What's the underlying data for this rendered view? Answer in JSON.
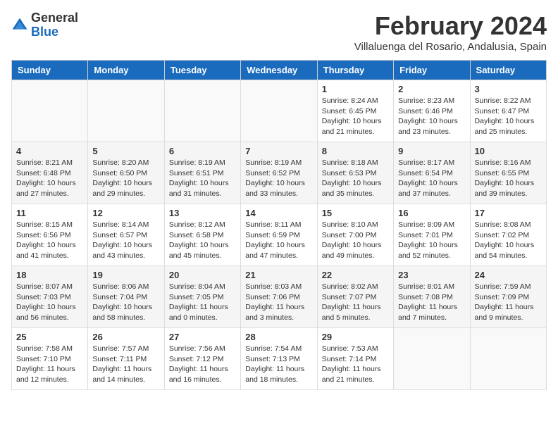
{
  "header": {
    "logo_general": "General",
    "logo_blue": "Blue",
    "title": "February 2024",
    "subtitle": "Villaluenga del Rosario, Andalusia, Spain"
  },
  "columns": [
    "Sunday",
    "Monday",
    "Tuesday",
    "Wednesday",
    "Thursday",
    "Friday",
    "Saturday"
  ],
  "weeks": [
    [
      {
        "day": "",
        "info": ""
      },
      {
        "day": "",
        "info": ""
      },
      {
        "day": "",
        "info": ""
      },
      {
        "day": "",
        "info": ""
      },
      {
        "day": "1",
        "info": "Sunrise: 8:24 AM\nSunset: 6:45 PM\nDaylight: 10 hours\nand 21 minutes."
      },
      {
        "day": "2",
        "info": "Sunrise: 8:23 AM\nSunset: 6:46 PM\nDaylight: 10 hours\nand 23 minutes."
      },
      {
        "day": "3",
        "info": "Sunrise: 8:22 AM\nSunset: 6:47 PM\nDaylight: 10 hours\nand 25 minutes."
      }
    ],
    [
      {
        "day": "4",
        "info": "Sunrise: 8:21 AM\nSunset: 6:48 PM\nDaylight: 10 hours\nand 27 minutes."
      },
      {
        "day": "5",
        "info": "Sunrise: 8:20 AM\nSunset: 6:50 PM\nDaylight: 10 hours\nand 29 minutes."
      },
      {
        "day": "6",
        "info": "Sunrise: 8:19 AM\nSunset: 6:51 PM\nDaylight: 10 hours\nand 31 minutes."
      },
      {
        "day": "7",
        "info": "Sunrise: 8:19 AM\nSunset: 6:52 PM\nDaylight: 10 hours\nand 33 minutes."
      },
      {
        "day": "8",
        "info": "Sunrise: 8:18 AM\nSunset: 6:53 PM\nDaylight: 10 hours\nand 35 minutes."
      },
      {
        "day": "9",
        "info": "Sunrise: 8:17 AM\nSunset: 6:54 PM\nDaylight: 10 hours\nand 37 minutes."
      },
      {
        "day": "10",
        "info": "Sunrise: 8:16 AM\nSunset: 6:55 PM\nDaylight: 10 hours\nand 39 minutes."
      }
    ],
    [
      {
        "day": "11",
        "info": "Sunrise: 8:15 AM\nSunset: 6:56 PM\nDaylight: 10 hours\nand 41 minutes."
      },
      {
        "day": "12",
        "info": "Sunrise: 8:14 AM\nSunset: 6:57 PM\nDaylight: 10 hours\nand 43 minutes."
      },
      {
        "day": "13",
        "info": "Sunrise: 8:12 AM\nSunset: 6:58 PM\nDaylight: 10 hours\nand 45 minutes."
      },
      {
        "day": "14",
        "info": "Sunrise: 8:11 AM\nSunset: 6:59 PM\nDaylight: 10 hours\nand 47 minutes."
      },
      {
        "day": "15",
        "info": "Sunrise: 8:10 AM\nSunset: 7:00 PM\nDaylight: 10 hours\nand 49 minutes."
      },
      {
        "day": "16",
        "info": "Sunrise: 8:09 AM\nSunset: 7:01 PM\nDaylight: 10 hours\nand 52 minutes."
      },
      {
        "day": "17",
        "info": "Sunrise: 8:08 AM\nSunset: 7:02 PM\nDaylight: 10 hours\nand 54 minutes."
      }
    ],
    [
      {
        "day": "18",
        "info": "Sunrise: 8:07 AM\nSunset: 7:03 PM\nDaylight: 10 hours\nand 56 minutes."
      },
      {
        "day": "19",
        "info": "Sunrise: 8:06 AM\nSunset: 7:04 PM\nDaylight: 10 hours\nand 58 minutes."
      },
      {
        "day": "20",
        "info": "Sunrise: 8:04 AM\nSunset: 7:05 PM\nDaylight: 11 hours\nand 0 minutes."
      },
      {
        "day": "21",
        "info": "Sunrise: 8:03 AM\nSunset: 7:06 PM\nDaylight: 11 hours\nand 3 minutes."
      },
      {
        "day": "22",
        "info": "Sunrise: 8:02 AM\nSunset: 7:07 PM\nDaylight: 11 hours\nand 5 minutes."
      },
      {
        "day": "23",
        "info": "Sunrise: 8:01 AM\nSunset: 7:08 PM\nDaylight: 11 hours\nand 7 minutes."
      },
      {
        "day": "24",
        "info": "Sunrise: 7:59 AM\nSunset: 7:09 PM\nDaylight: 11 hours\nand 9 minutes."
      }
    ],
    [
      {
        "day": "25",
        "info": "Sunrise: 7:58 AM\nSunset: 7:10 PM\nDaylight: 11 hours\nand 12 minutes."
      },
      {
        "day": "26",
        "info": "Sunrise: 7:57 AM\nSunset: 7:11 PM\nDaylight: 11 hours\nand 14 minutes."
      },
      {
        "day": "27",
        "info": "Sunrise: 7:56 AM\nSunset: 7:12 PM\nDaylight: 11 hours\nand 16 minutes."
      },
      {
        "day": "28",
        "info": "Sunrise: 7:54 AM\nSunset: 7:13 PM\nDaylight: 11 hours\nand 18 minutes."
      },
      {
        "day": "29",
        "info": "Sunrise: 7:53 AM\nSunset: 7:14 PM\nDaylight: 11 hours\nand 21 minutes."
      },
      {
        "day": "",
        "info": ""
      },
      {
        "day": "",
        "info": ""
      }
    ]
  ]
}
